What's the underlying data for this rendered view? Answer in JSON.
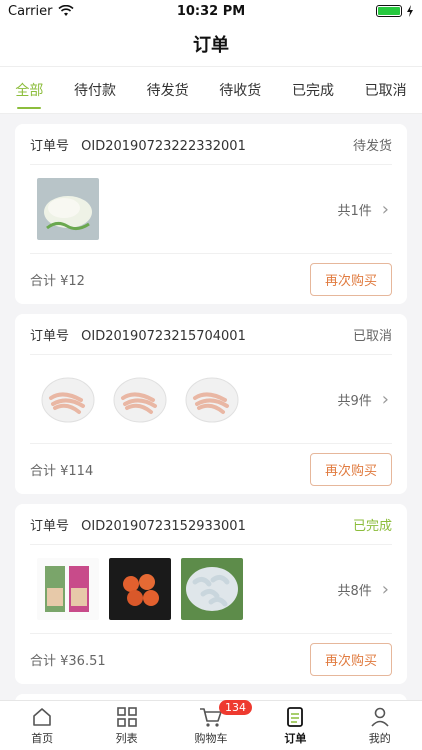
{
  "status_bar": {
    "carrier": "Carrier",
    "time": "10:32 PM"
  },
  "nav": {
    "title": "订单"
  },
  "tabs": [
    "全部",
    "待付款",
    "待发货",
    "待收货",
    "已完成",
    "已取消"
  ],
  "orders": [
    {
      "order_label": "订单号",
      "order_id": "OID20190723222332001",
      "status": "待发货",
      "count_text": "共1件",
      "total": "合计 ¥12",
      "rebuy": "再次购买"
    },
    {
      "order_label": "订单号",
      "order_id": "OID20190723215704001",
      "status": "已取消",
      "count_text": "共9件",
      "total": "合计 ¥114",
      "rebuy": "再次购买"
    },
    {
      "order_label": "订单号",
      "order_id": "OID20190723152933001",
      "status": "已完成",
      "count_text": "共8件",
      "total": "合计 ¥36.51",
      "rebuy": "再次购买"
    }
  ],
  "tabbar": {
    "items": [
      "首页",
      "列表",
      "购物车",
      "订单",
      "我的"
    ],
    "cart_badge": "134"
  },
  "colors": {
    "accent": "#8cbd3c",
    "rebuy": "#e07a3e",
    "badge": "#ee3a2f"
  }
}
